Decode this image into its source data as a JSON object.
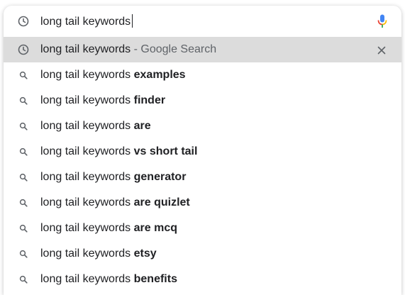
{
  "search": {
    "query": "long tail keywords",
    "mic_icon": "microphone-icon",
    "history_icon": "clock-history-icon"
  },
  "history_suggestion": {
    "prefix": "long tail keywords",
    "suffix": " - Google Search",
    "remove_icon": "close-icon"
  },
  "suggestions": [
    {
      "prefix": "long tail keywords ",
      "completion": "examples"
    },
    {
      "prefix": "long tail keywords ",
      "completion": "finder"
    },
    {
      "prefix": "long tail keywords ",
      "completion": "are"
    },
    {
      "prefix": "long tail keywords ",
      "completion": "vs short tail"
    },
    {
      "prefix": "long tail keywords ",
      "completion": "generator"
    },
    {
      "prefix": "long tail keywords ",
      "completion": "are quizlet"
    },
    {
      "prefix": "long tail keywords ",
      "completion": "are mcq"
    },
    {
      "prefix": "long tail keywords ",
      "completion": "etsy"
    },
    {
      "prefix": "long tail keywords ",
      "completion": "benefits"
    }
  ],
  "colors": {
    "highlight": "#dcdcdc",
    "text": "#202124",
    "muted": "#5f6368",
    "mic_blue": "#4285f4",
    "mic_red": "#ea4335",
    "mic_yellow": "#fbbc05",
    "mic_green": "#34a853"
  }
}
